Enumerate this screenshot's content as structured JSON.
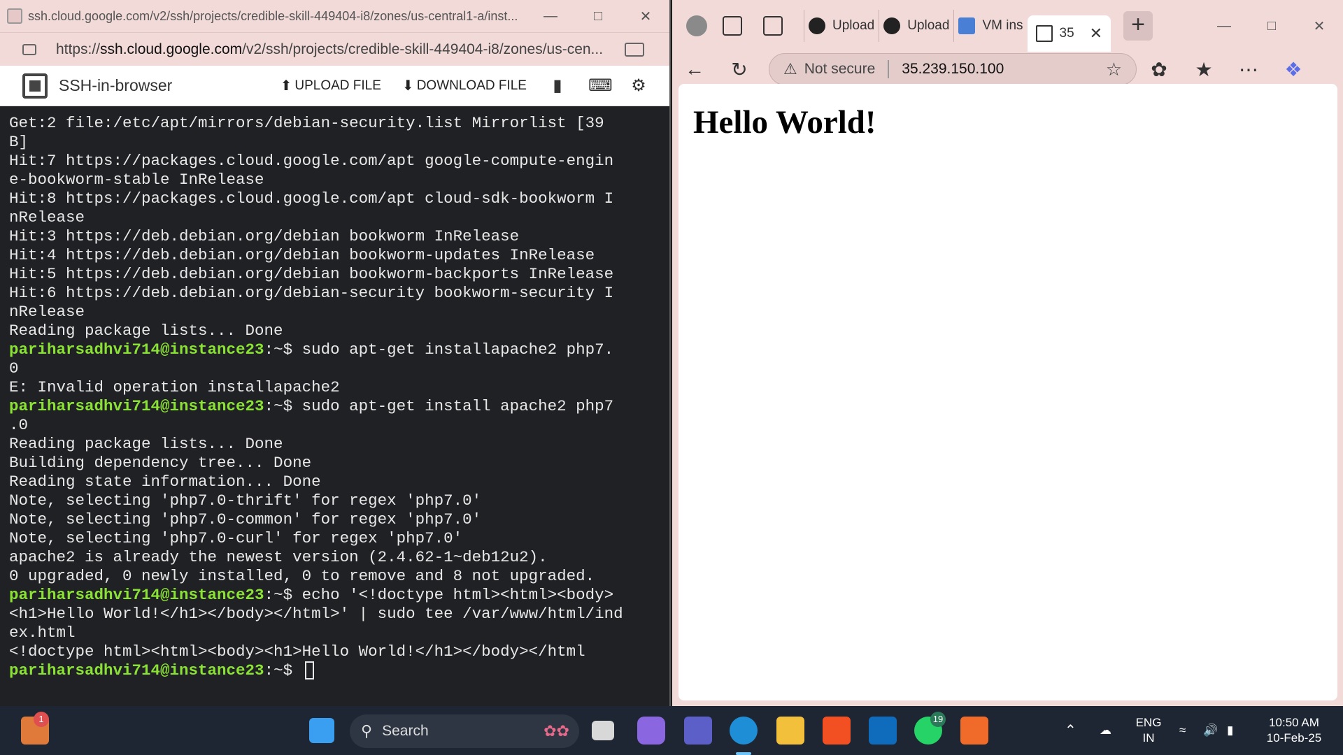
{
  "ssh_window": {
    "title": "ssh.cloud.google.com/v2/ssh/projects/credible-skill-449404-i8/zones/us-central1-a/inst...",
    "url_prefix": "https://",
    "url_domain": "ssh.cloud.google.com",
    "url_rest": "/v2/ssh/projects/credible-skill-449404-i8/zones/us-cen...",
    "app_title": "SSH-in-browser",
    "upload_label": "UPLOAD FILE",
    "download_label": "DOWNLOAD FILE"
  },
  "terminal": {
    "prompt": "pariharsadhvi714@instance23",
    "prompt_suffix": ":~$ ",
    "lines": [
      {
        "type": "text",
        "text": "Get:2 file:/etc/apt/mirrors/debian-security.list Mirrorlist [39"
      },
      {
        "type": "text",
        "text": "B]"
      },
      {
        "type": "text",
        "text": "Hit:7 https://packages.cloud.google.com/apt google-compute-engin"
      },
      {
        "type": "text",
        "text": "e-bookworm-stable InRelease"
      },
      {
        "type": "text",
        "text": "Hit:8 https://packages.cloud.google.com/apt cloud-sdk-bookworm I"
      },
      {
        "type": "text",
        "text": "nRelease"
      },
      {
        "type": "text",
        "text": "Hit:3 https://deb.debian.org/debian bookworm InRelease"
      },
      {
        "type": "text",
        "text": "Hit:4 https://deb.debian.org/debian bookworm-updates InRelease"
      },
      {
        "type": "text",
        "text": "Hit:5 https://deb.debian.org/debian bookworm-backports InRelease"
      },
      {
        "type": "text",
        "text": "Hit:6 https://deb.debian.org/debian-security bookworm-security I"
      },
      {
        "type": "text",
        "text": "nRelease"
      },
      {
        "type": "text",
        "text": "Reading package lists... Done"
      },
      {
        "type": "prompt",
        "text": "sudo apt-get installapache2 php7."
      },
      {
        "type": "text",
        "text": "0"
      },
      {
        "type": "text",
        "text": "E: Invalid operation installapache2"
      },
      {
        "type": "prompt",
        "text": "sudo apt-get install apache2 php7"
      },
      {
        "type": "text",
        "text": ".0"
      },
      {
        "type": "text",
        "text": "Reading package lists... Done"
      },
      {
        "type": "text",
        "text": "Building dependency tree... Done"
      },
      {
        "type": "text",
        "text": "Reading state information... Done"
      },
      {
        "type": "text",
        "text": "Note, selecting 'php7.0-thrift' for regex 'php7.0'"
      },
      {
        "type": "text",
        "text": "Note, selecting 'php7.0-common' for regex 'php7.0'"
      },
      {
        "type": "text",
        "text": "Note, selecting 'php7.0-curl' for regex 'php7.0'"
      },
      {
        "type": "text",
        "text": "apache2 is already the newest version (2.4.62-1~deb12u2)."
      },
      {
        "type": "text",
        "text": "0 upgraded, 0 newly installed, 0 to remove and 8 not upgraded."
      },
      {
        "type": "prompt",
        "text": "echo '<!doctype html><html><body>"
      },
      {
        "type": "text",
        "text": "<h1>Hello World!</h1></body></html>' | sudo tee /var/www/html/ind"
      },
      {
        "type": "text",
        "text": "ex.html"
      },
      {
        "type": "text",
        "text": "<!doctype html><html><body><h1>Hello World!</h1></body></html"
      },
      {
        "type": "prompt",
        "text": ""
      }
    ]
  },
  "edge_window": {
    "tabs": [
      {
        "label": "Upload",
        "icon": "github-icon"
      },
      {
        "label": "Upload",
        "icon": "github-icon"
      },
      {
        "label": "VM ins",
        "icon": "vm-icon"
      },
      {
        "label": "35",
        "icon": "page-icon"
      }
    ],
    "not_secure_label": "Not secure",
    "address": "35.239.150.100",
    "page_heading": "Hello World!"
  },
  "taskbar": {
    "search_label": "Search",
    "widgets_badge": "1",
    "whatsapp_badge": "19",
    "language_top": "ENG",
    "language_bottom": "IN",
    "time": "10:50 AM",
    "date": "10-Feb-25"
  },
  "colors": {
    "titlebar": "#f2dad9",
    "terminal_bg": "#202124",
    "prompt_green": "#8ae234",
    "taskbar_bg": "#1f2633"
  }
}
